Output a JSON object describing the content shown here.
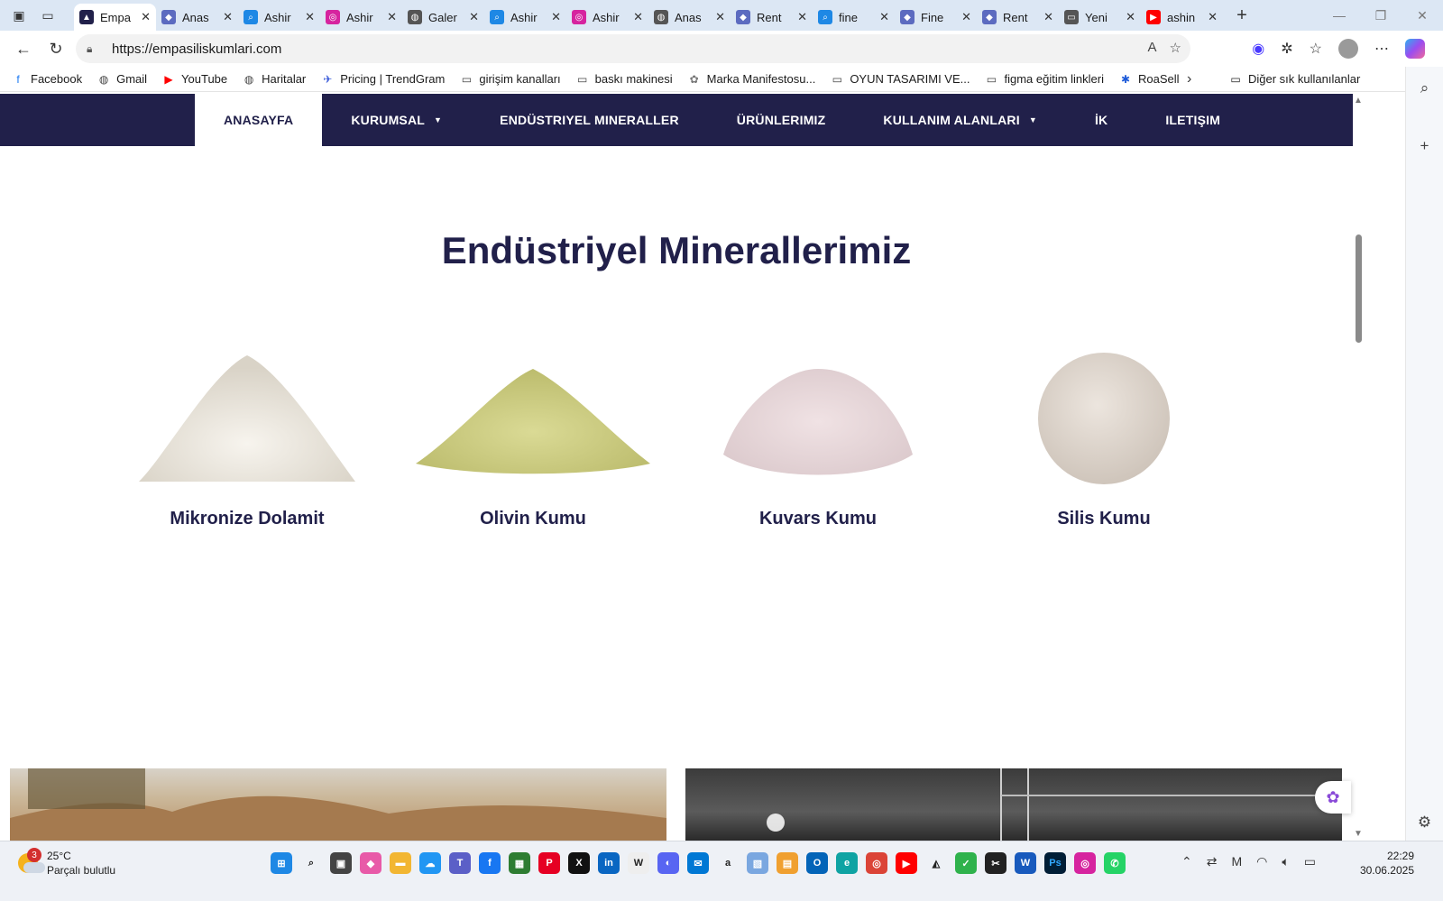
{
  "browser": {
    "tabs": [
      {
        "label": "Empa",
        "active": true,
        "favicon": "empa-logo-icon"
      },
      {
        "label": "Anas",
        "favicon": "site-icon"
      },
      {
        "label": "Ashir",
        "favicon": "search-icon"
      },
      {
        "label": "Ashir",
        "favicon": "instagram-icon"
      },
      {
        "label": "Galer",
        "favicon": "globe-icon"
      },
      {
        "label": "Ashir",
        "favicon": "search-icon"
      },
      {
        "label": "Ashir",
        "favicon": "instagram-icon"
      },
      {
        "label": "Anas",
        "favicon": "globe-icon"
      },
      {
        "label": "Rent",
        "favicon": "site-icon"
      },
      {
        "label": "fine",
        "favicon": "search-icon"
      },
      {
        "label": "Fine",
        "favicon": "site-icon"
      },
      {
        "label": "Rent",
        "favicon": "site-icon"
      },
      {
        "label": "Yeni",
        "favicon": "newtab-icon"
      },
      {
        "label": "ashin",
        "favicon": "youtube-icon"
      }
    ],
    "url": "https://empasiliskumlari.com",
    "bookmarks": [
      {
        "label": "Facebook",
        "icon": "facebook-icon"
      },
      {
        "label": "Gmail",
        "icon": "globe-icon"
      },
      {
        "label": "YouTube",
        "icon": "youtube-icon"
      },
      {
        "label": "Haritalar",
        "icon": "globe-icon"
      },
      {
        "label": "Pricing | TrendGram",
        "icon": "trendgram-icon"
      },
      {
        "label": "girişim kanalları",
        "icon": "folder-icon"
      },
      {
        "label": "baskı makinesi",
        "icon": "folder-icon"
      },
      {
        "label": "Marka Manifestosu...",
        "icon": "site-icon"
      },
      {
        "label": "OYUN TASARIMI VE...",
        "icon": "folder-icon"
      },
      {
        "label": "figma eğitim linkleri",
        "icon": "folder-icon"
      },
      {
        "label": "RoaSell",
        "icon": "roasell-icon"
      }
    ],
    "other_bookmarks": "Diğer sık kullanılanlar"
  },
  "site": {
    "nav": [
      {
        "label": "ANASAYFA",
        "active": true
      },
      {
        "label": "KURUMSAL",
        "dropdown": true
      },
      {
        "label": "ENDÜSTRIYEL MINERALLER"
      },
      {
        "label": "ÜRÜNLERIMIZ"
      },
      {
        "label": "KULLANIM ALANLARI",
        "dropdown": true
      },
      {
        "label": "İK"
      },
      {
        "label": "ILETIŞIM"
      }
    ],
    "section_title": "Endüstriyel Minerallerimiz",
    "minerals": [
      {
        "label": "Mikronize Dolamit",
        "color": "#ece7df"
      },
      {
        "label": "Olivin Kumu",
        "color": "#cfcf86"
      },
      {
        "label": "Kuvars Kumu",
        "color": "#ead9dc"
      },
      {
        "label": "Silis Kumu",
        "color": "#e3dbd4"
      }
    ]
  },
  "taskbar": {
    "weather_temp": "25°C",
    "weather_desc": "Parçalı bulutlu",
    "weather_badge": "3",
    "time": "22:29",
    "date": "30.06.2025"
  },
  "colors": {
    "nav_bg": "#21204a",
    "heading": "#21204a"
  }
}
